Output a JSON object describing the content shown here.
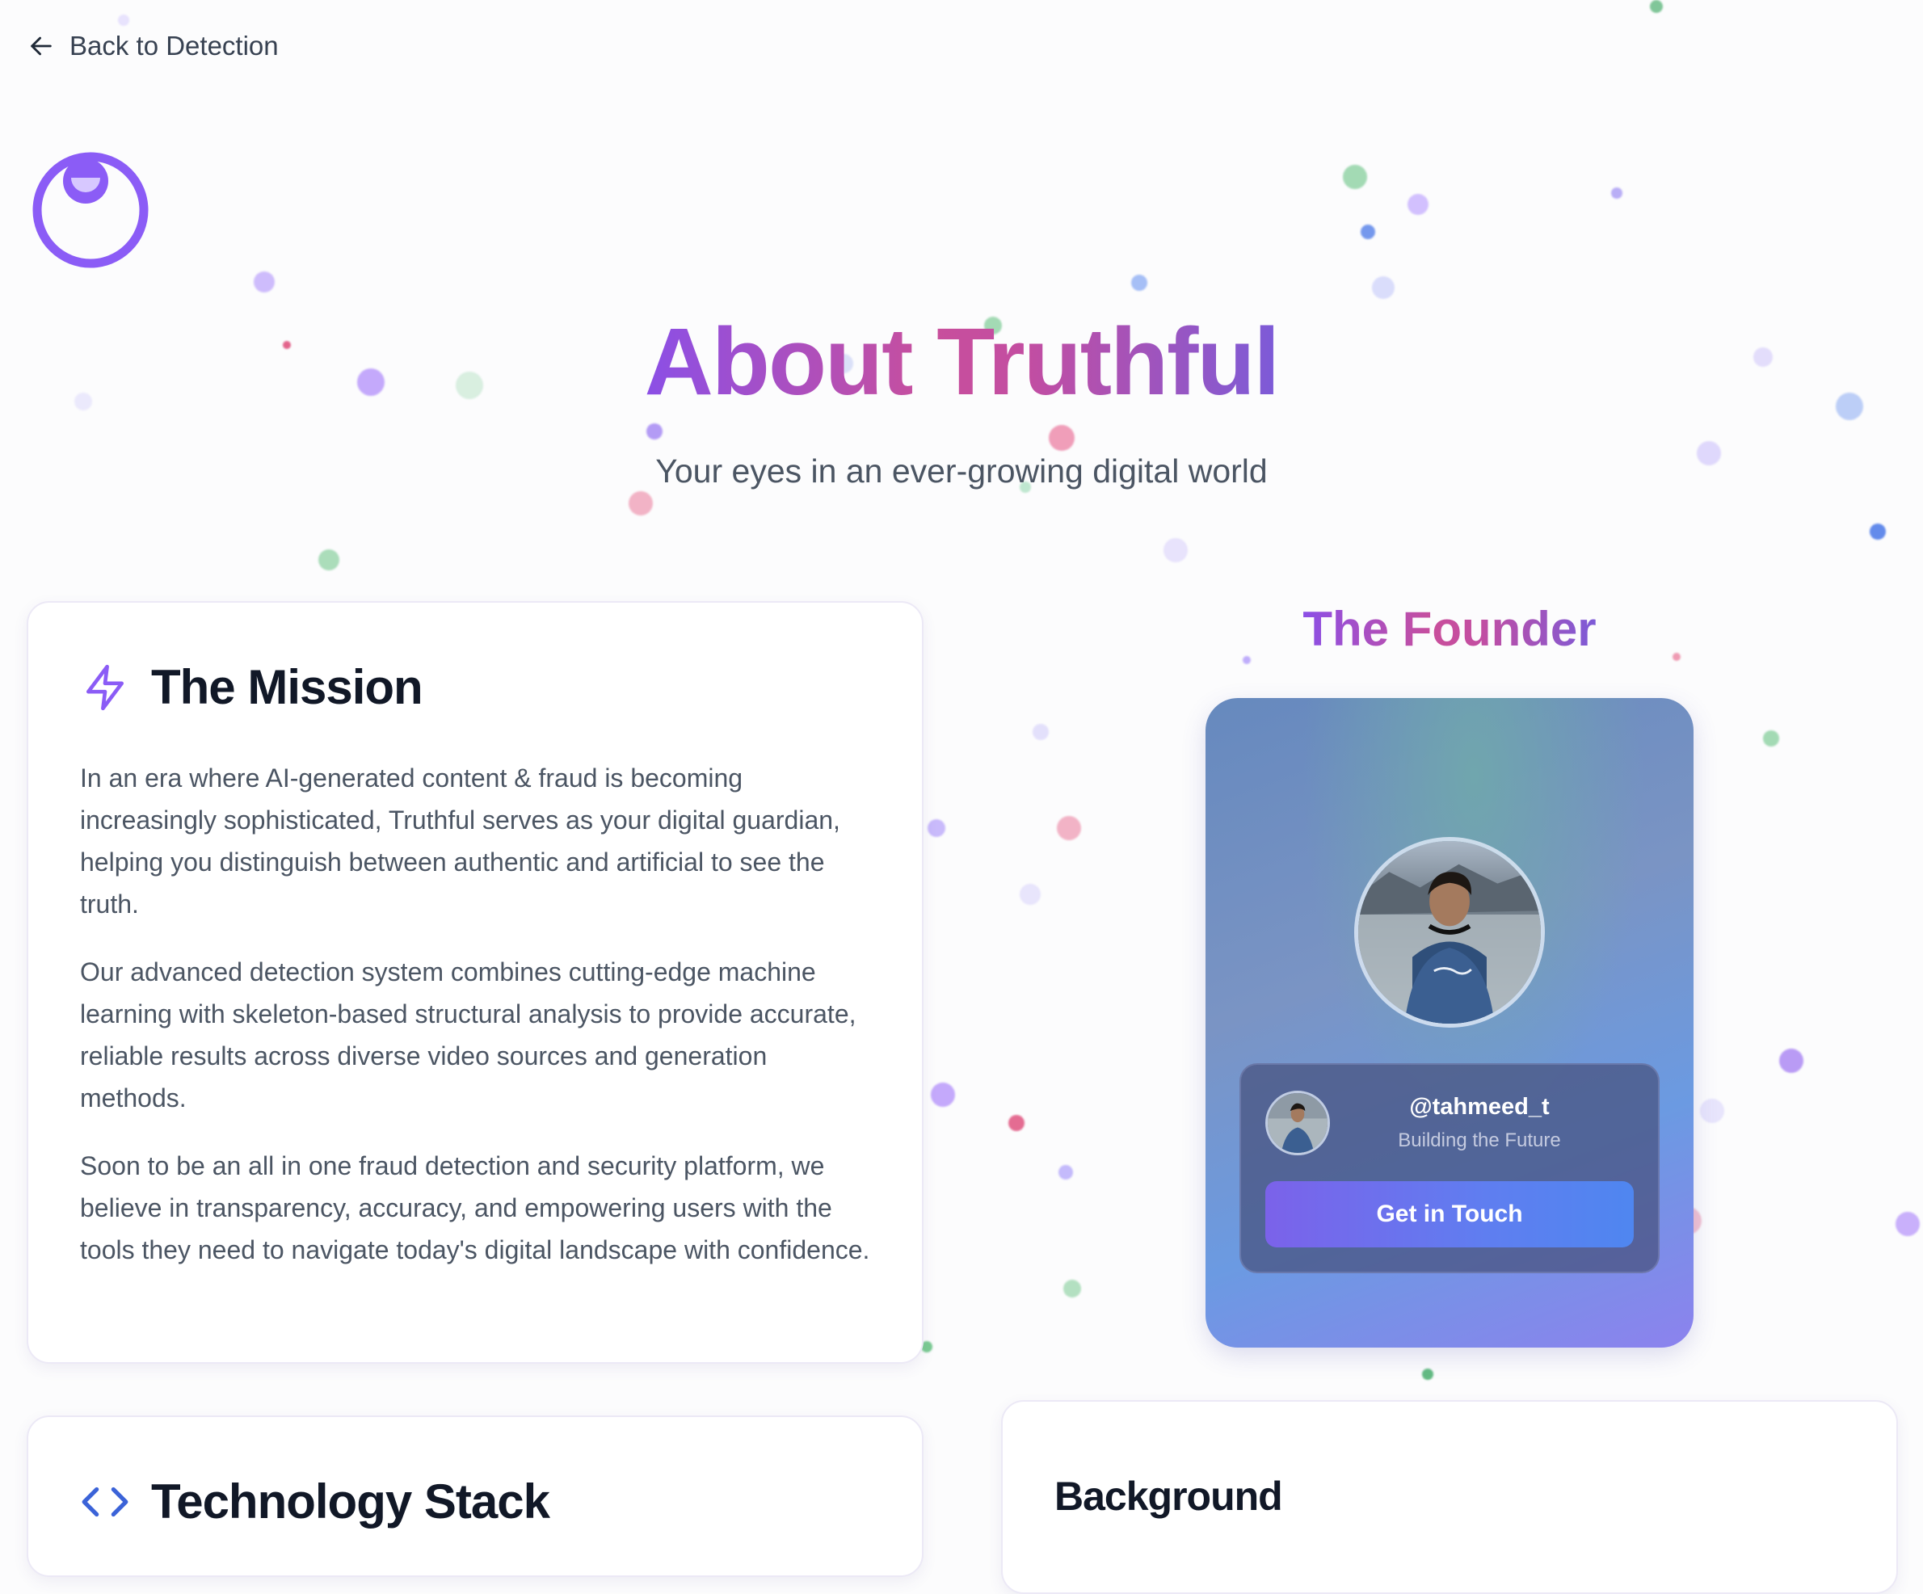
{
  "nav": {
    "back_label": "Back to Detection"
  },
  "hero": {
    "title": "About Truthful",
    "subtitle": "Your eyes in an ever-growing digital world"
  },
  "mission": {
    "title": "The Mission",
    "paragraphs": [
      "In an era where AI-generated content & fraud is becoming increasingly sophisticated, Truthful serves as your digital guardian, helping you distinguish between authentic and artificial to see the truth.",
      "Our advanced detection system combines cutting-edge machine learning with skeleton-based structural analysis to provide accurate, reliable results across diverse video sources and generation methods.",
      "Soon to be an all in one fraud detection and security platform, we believe in transparency, accuracy, and empowering users with the tools they need to navigate today's digital landscape with confidence."
    ]
  },
  "founder": {
    "heading": "The Founder",
    "handle": "@tahmeed_t",
    "tagline": "Building the Future",
    "cta_label": "Get in Touch"
  },
  "tech": {
    "title": "Technology Stack"
  },
  "background": {
    "title": "Background"
  },
  "colors": {
    "accent_purple": "#8b5cf6",
    "accent_pink": "#c84f9c",
    "accent_blue": "#3b63d8"
  },
  "icons": {
    "back": "arrow-left-icon",
    "logo": "eye-logo-icon",
    "mission": "lightning-bolt-icon",
    "tech": "code-brackets-icon"
  }
}
